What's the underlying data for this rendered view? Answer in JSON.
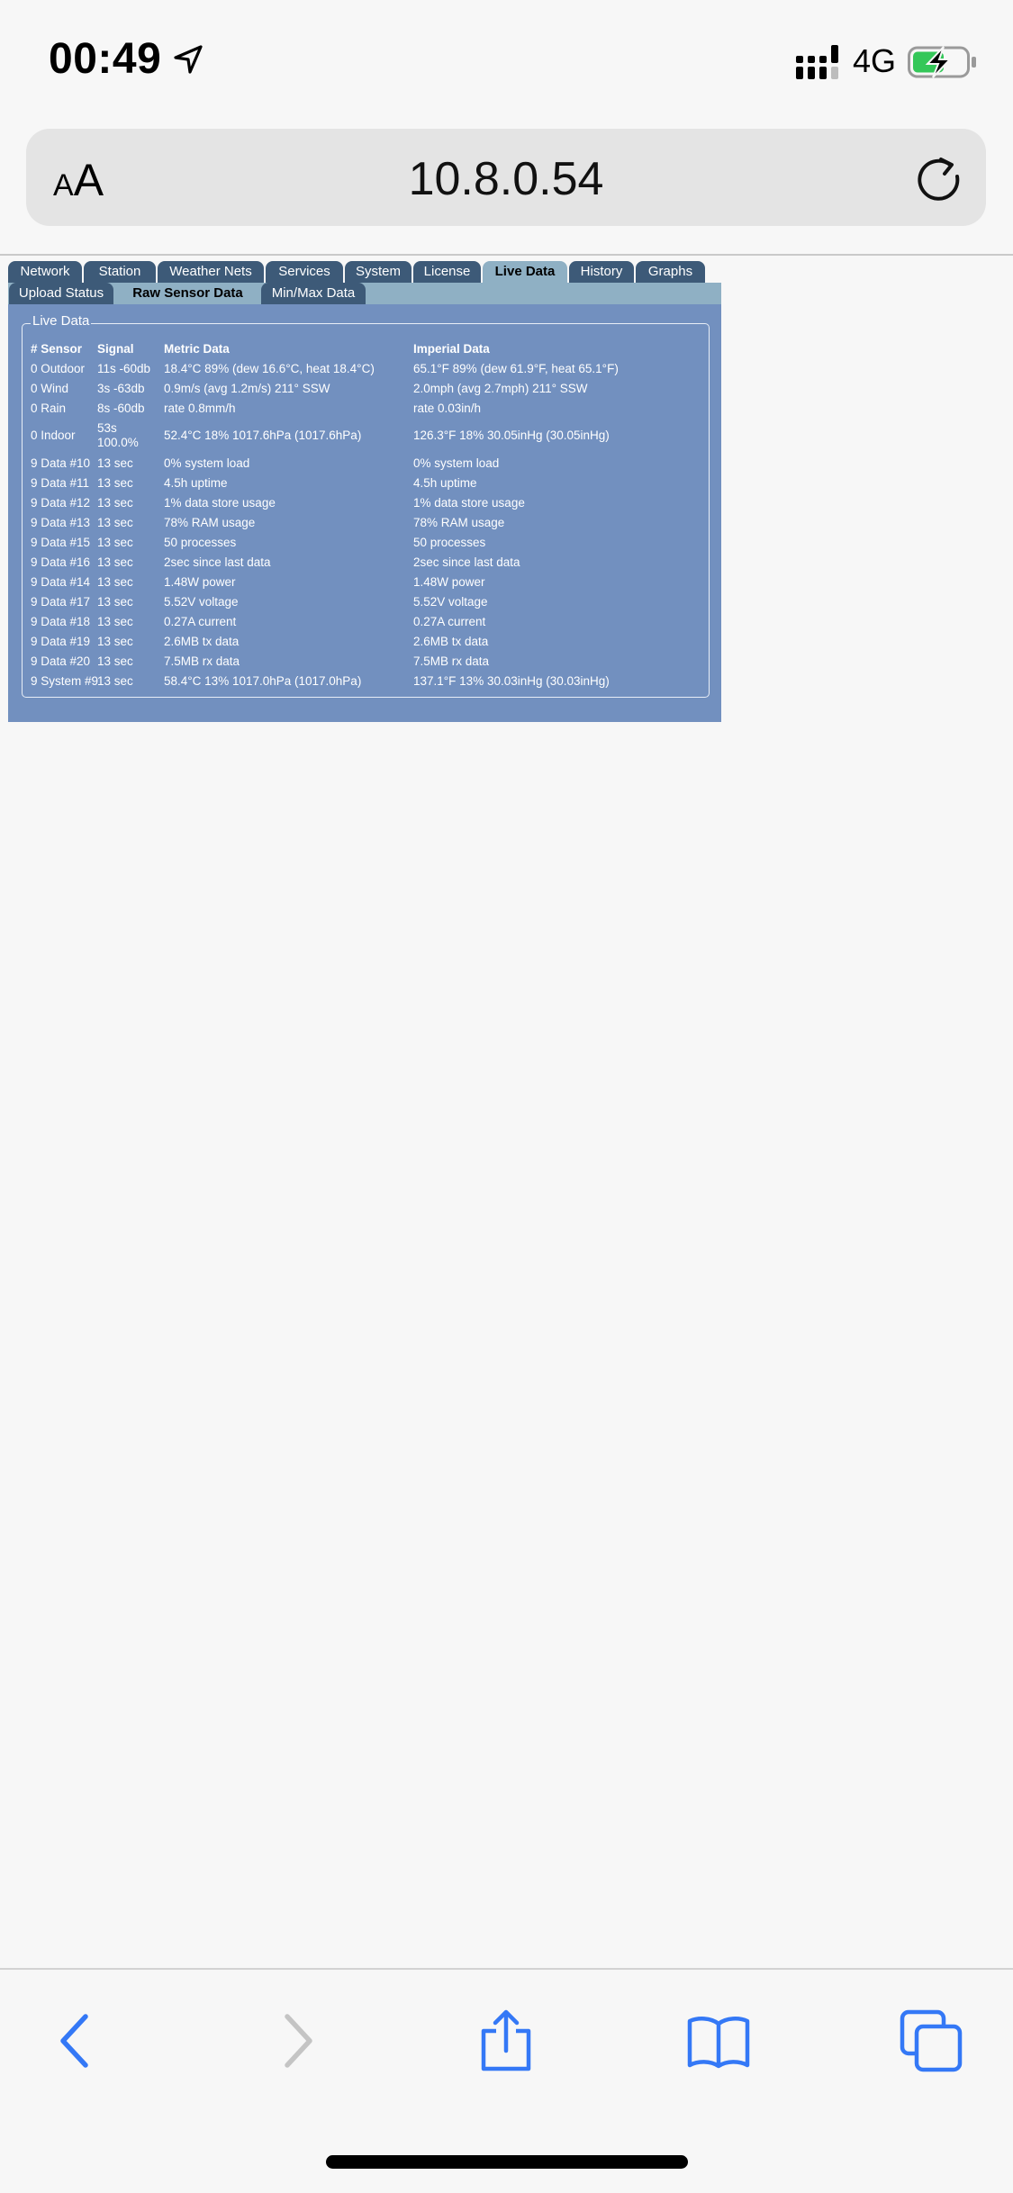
{
  "status_bar": {
    "time": "00:49",
    "network_type": "4G",
    "icons": [
      "location-arrow-icon",
      "signal-icon",
      "battery-charging-icon"
    ],
    "battery_color": "#34c759"
  },
  "address_bar": {
    "aa_small": "A",
    "aa_big": "A",
    "url": "10.8.0.54",
    "icons": [
      "reload-icon"
    ]
  },
  "main_tabs": [
    "Network",
    "Station",
    "Weather Nets",
    "Services",
    "System",
    "License",
    "Live Data",
    "History",
    "Graphs"
  ],
  "active_main_tab": "Live Data",
  "sub_tabs": [
    "Upload Status",
    "Raw Sensor Data",
    "Min/Max Data"
  ],
  "active_sub_tab": "Raw Sensor Data",
  "live_data": {
    "legend": "Live Data",
    "headers": [
      "# Sensor",
      "Signal",
      "Metric Data",
      "Imperial Data"
    ],
    "rows": [
      {
        "sensor": "0 Outdoor",
        "signal": "11s -60db",
        "metric": "18.4°C 89% (dew 16.6°C, heat 18.4°C)",
        "imperial": "65.1°F 89% (dew 61.9°F, heat 65.1°F)"
      },
      {
        "sensor": "0 Wind",
        "signal": "3s -63db",
        "metric": "0.9m/s (avg 1.2m/s) 211° SSW",
        "imperial": "2.0mph (avg 2.7mph) 211° SSW"
      },
      {
        "sensor": "0 Rain",
        "signal": "8s -60db",
        "metric": "rate 0.8mm/h",
        "imperial": "rate 0.03in/h"
      },
      {
        "sensor": "0 Indoor",
        "signal": "53s",
        "signal2": "100.0%",
        "metric": "52.4°C 18% 1017.6hPa (1017.6hPa)",
        "imperial": "126.3°F 18% 30.05inHg (30.05inHg)"
      },
      {
        "sensor": "9 Data #10",
        "signal": "13 sec",
        "metric": "0% system load",
        "imperial": "0% system load"
      },
      {
        "sensor": "9 Data #11",
        "signal": "13 sec",
        "metric": "4.5h uptime",
        "imperial": "4.5h uptime"
      },
      {
        "sensor": "9 Data #12",
        "signal": "13 sec",
        "metric": "1% data store usage",
        "imperial": "1% data store usage"
      },
      {
        "sensor": "9 Data #13",
        "signal": "13 sec",
        "metric": "78% RAM usage",
        "imperial": "78% RAM usage"
      },
      {
        "sensor": "9 Data #15",
        "signal": "13 sec",
        "metric": "50 processes",
        "imperial": "50 processes"
      },
      {
        "sensor": "9 Data #16",
        "signal": "13 sec",
        "metric": "2sec since last data",
        "imperial": "2sec since last data"
      },
      {
        "sensor": "9 Data #14",
        "signal": "13 sec",
        "metric": "1.48W power",
        "imperial": "1.48W power"
      },
      {
        "sensor": "9 Data #17",
        "signal": "13 sec",
        "metric": "5.52V voltage",
        "imperial": "5.52V voltage"
      },
      {
        "sensor": "9 Data #18",
        "signal": "13 sec",
        "metric": "0.27A current",
        "imperial": "0.27A current"
      },
      {
        "sensor": "9 Data #19",
        "signal": "13 sec",
        "metric": "2.6MB tx data",
        "imperial": "2.6MB tx data"
      },
      {
        "sensor": "9 Data #20",
        "signal": "13 sec",
        "metric": "7.5MB rx data",
        "imperial": "7.5MB rx data"
      },
      {
        "sensor": "9 System #9",
        "signal": "13 sec",
        "metric": "58.4°C 13% 1017.0hPa (1017.0hPa)",
        "imperial": "137.1°F 13% 30.03inHg (30.03inHg)"
      }
    ]
  },
  "toolbar": {
    "icons": [
      "back-icon",
      "forward-icon",
      "share-icon",
      "bookmarks-icon",
      "tabs-icon"
    ],
    "accent_color": "#3478f6",
    "disabled_color": "#c4c4c4"
  }
}
